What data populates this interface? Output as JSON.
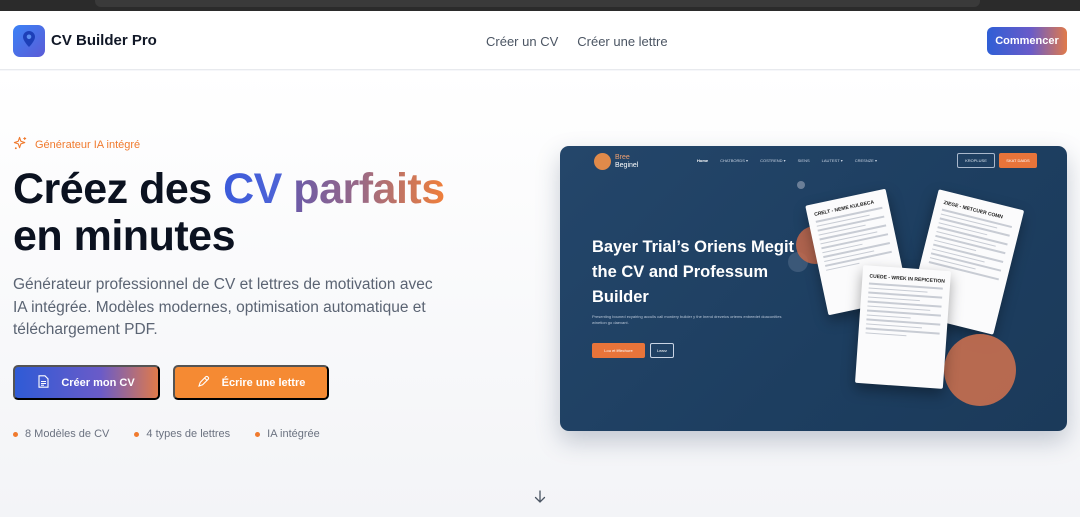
{
  "app": {
    "name": "CV Builder Pro"
  },
  "nav": {
    "links": [
      "Créer un CV",
      "Créer une lettre"
    ],
    "cta_label": "Commencer"
  },
  "hero": {
    "badge": "Générateur IA intégré",
    "title_part1": "Créez des ",
    "title_cv": "CV",
    "title_space": " ",
    "title_parfaits": "parfaits",
    "title_line2": "en minutes",
    "subtitle": "Générateur professionnel de CV et lettres de motivation avec IA intégrée. Modèles modernes, optimisation automatique et téléchargement PDF.",
    "btn_primary": "Créer mon CV",
    "btn_secondary": "Écrire une lettre",
    "features": [
      "8 Modèles de CV",
      "4 types de lettres",
      "IA intégrée"
    ]
  },
  "mockup": {
    "brand_line1": "Bree",
    "brand_line2": "Beginel",
    "nav": [
      "Home",
      "CHATBORDS ▾",
      "COSTREND ▾",
      "SIENS",
      "LAUTEST ▾",
      "CRESNZE ▾"
    ],
    "btn_outline": "KROPLUSE",
    "btn_orange": "SKAT DAIDS",
    "title": "Bayer Trial’s Oriens Megit the CV and Professum Builder",
    "desc": "Presenting bouned ecyairing acculls call mordery builder y the Inend drezeics ortems enbeedet doaconitles winetion go daexant.",
    "btn1": "Lou et lfflechure",
    "btn2": "Learz",
    "paper1_title": "CRELT - NEME KULBECA",
    "paper2_title": "ZIEGE - METCUER COMN",
    "paper3_title": "CUEDE - WREK IN REPICETION"
  },
  "colors": {
    "accent_blue": "#2f5bd6",
    "accent_orange": "#f58a33",
    "mockup_bg": "#1f4163"
  },
  "icons": {
    "logo": "pin-icon",
    "badge": "sparkle-icon",
    "btn_primary": "document-icon",
    "btn_secondary": "pen-icon",
    "scroll": "arrow-down-icon"
  }
}
